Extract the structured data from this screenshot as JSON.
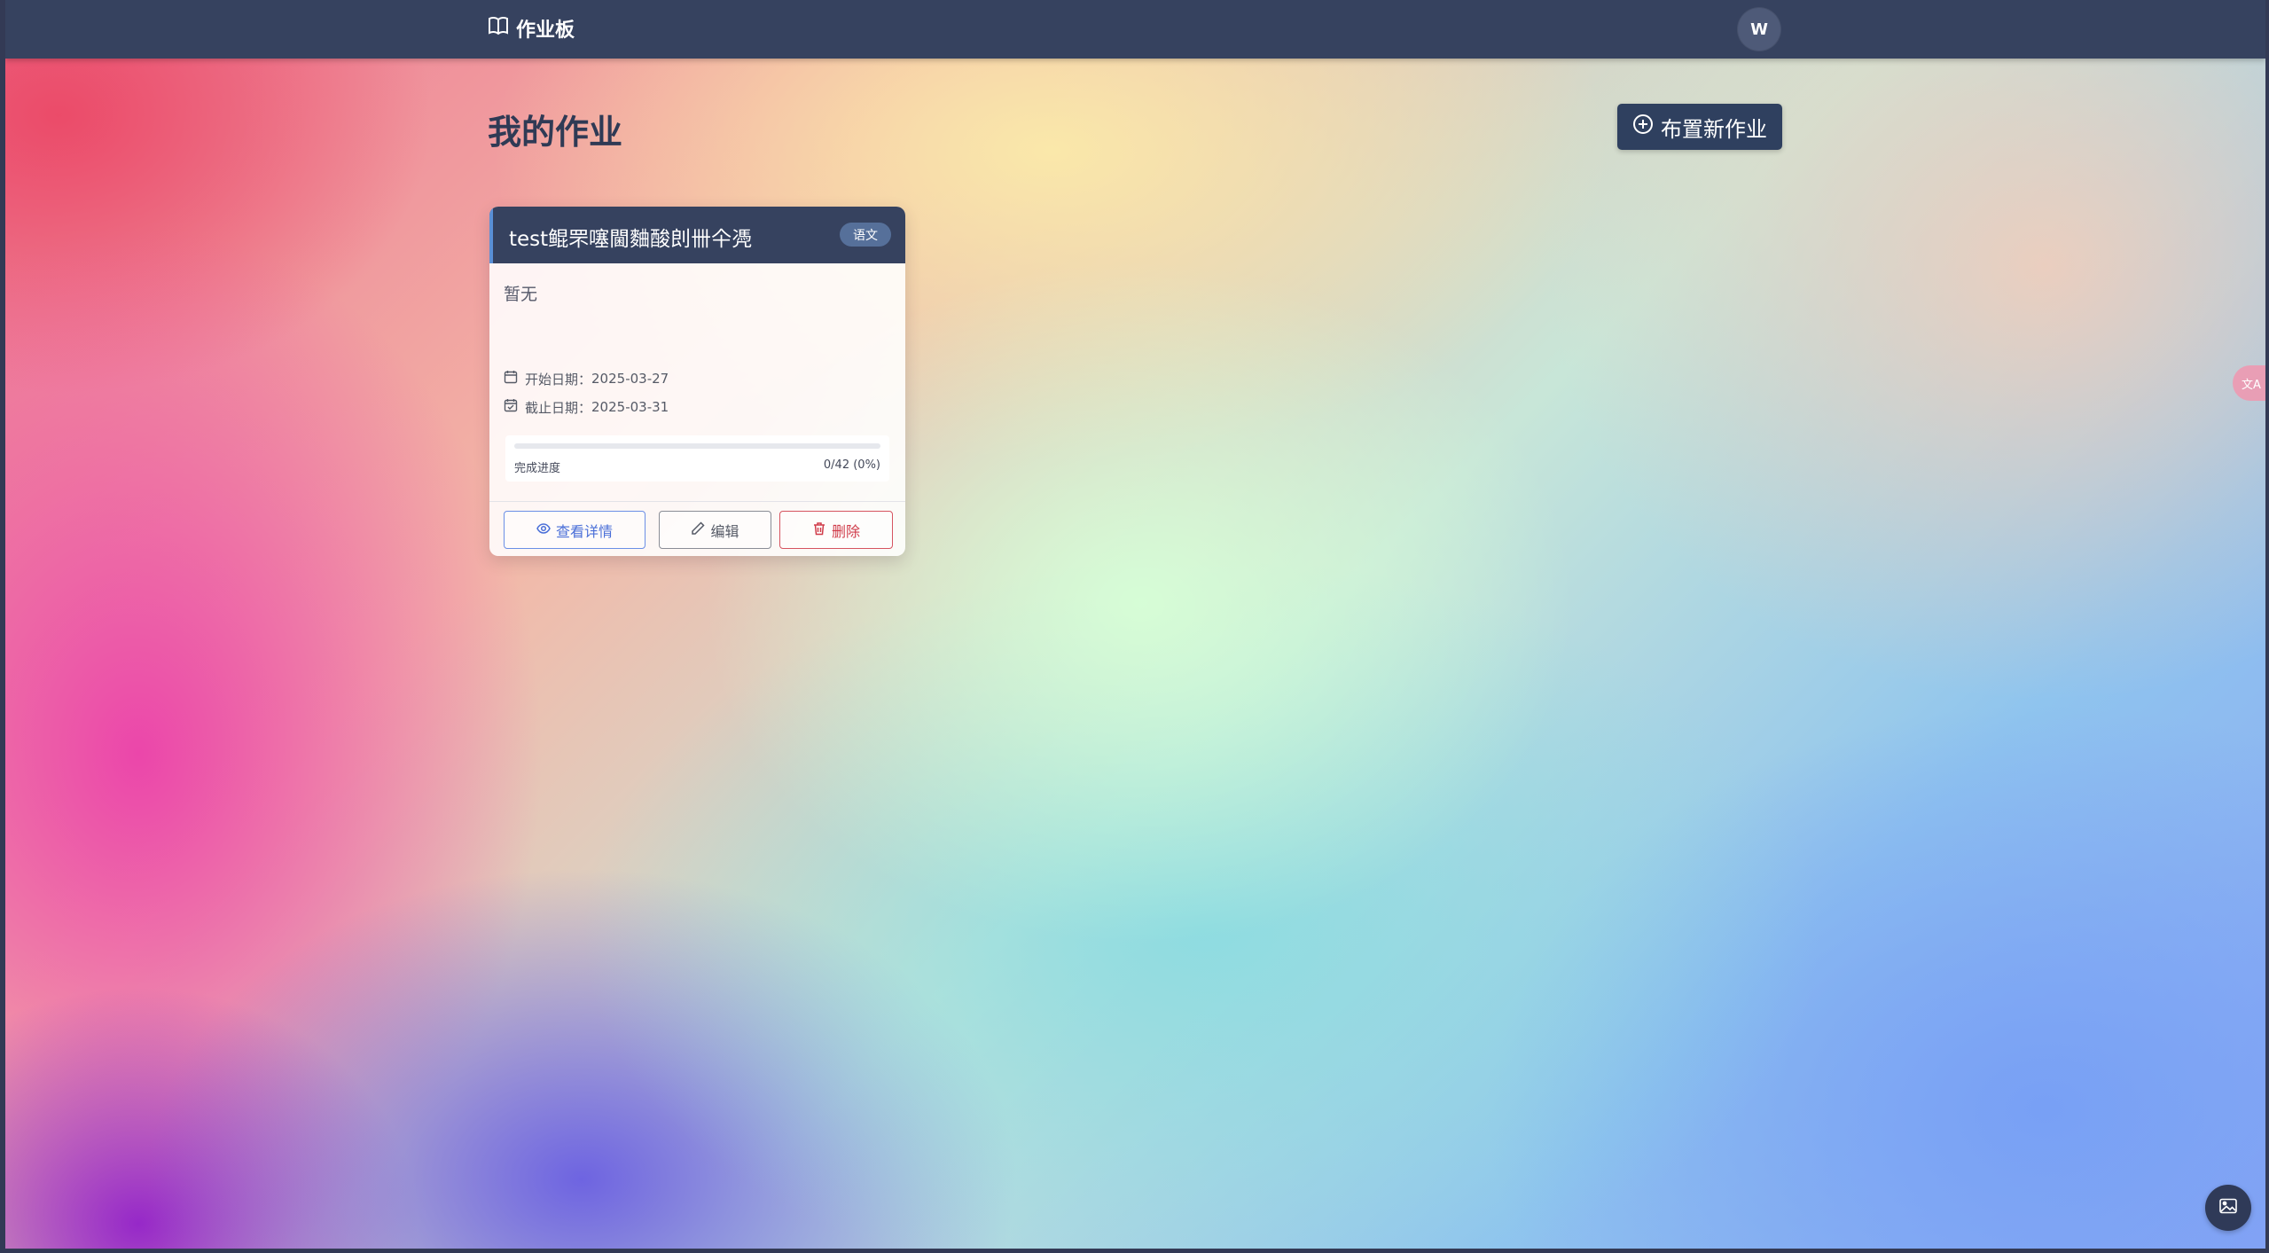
{
  "app": {
    "brand": "作业板",
    "user_initial": "W"
  },
  "page": {
    "title": "我的作业",
    "new_button_label": "布置新作业"
  },
  "assignments": [
    {
      "title": "test鲲罘噻閫麯酸剆卌仐凴",
      "subject": "语文",
      "description": "暂无",
      "start_label": "开始日期：",
      "start_date": "2025-03-27",
      "due_label": "截止日期：",
      "due_date": "2025-03-31",
      "progress_label": "完成进度",
      "progress_text": "0/42 (0%)",
      "progress_fraction": 0,
      "actions": {
        "view": "查看详情",
        "edit": "编辑",
        "delete": "删除"
      }
    }
  ],
  "floating": {
    "translate_label": "文A"
  },
  "colors": {
    "nav_bg": "#36425f",
    "primary_button": "#2f405f",
    "view_accent": "#4a6fd8",
    "delete_accent": "#d03c4a"
  }
}
